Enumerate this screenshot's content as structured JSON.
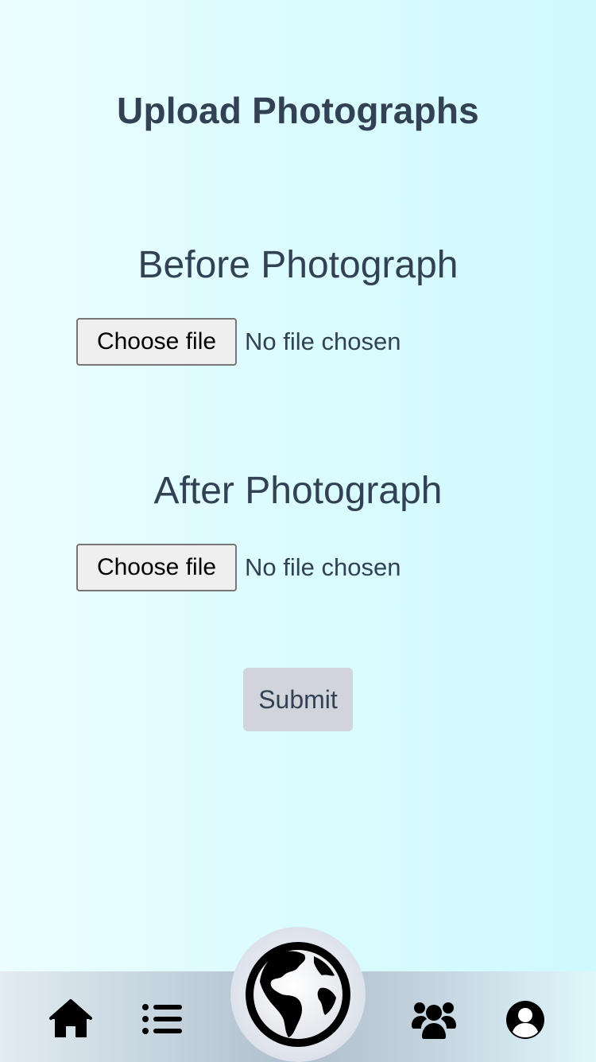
{
  "page": {
    "title": "Upload Photographs"
  },
  "before": {
    "heading": "Before Photograph",
    "choose_label": "Choose file",
    "status": "No file chosen"
  },
  "after": {
    "heading": "After Photograph",
    "choose_label": "Choose file",
    "status": "No file chosen"
  },
  "submit": {
    "label": "Submit"
  },
  "nav": {
    "items": [
      {
        "icon": "home-icon"
      },
      {
        "icon": "list-icon"
      },
      {
        "icon": "globe-icon"
      },
      {
        "icon": "users-icon"
      },
      {
        "icon": "user-circle-icon"
      }
    ]
  },
  "colors": {
    "text": "#334155",
    "button_bg": "#efefef",
    "submit_bg": "#d1d5db",
    "background_left": "#ecfeff",
    "background_right": "#cff9fd"
  }
}
